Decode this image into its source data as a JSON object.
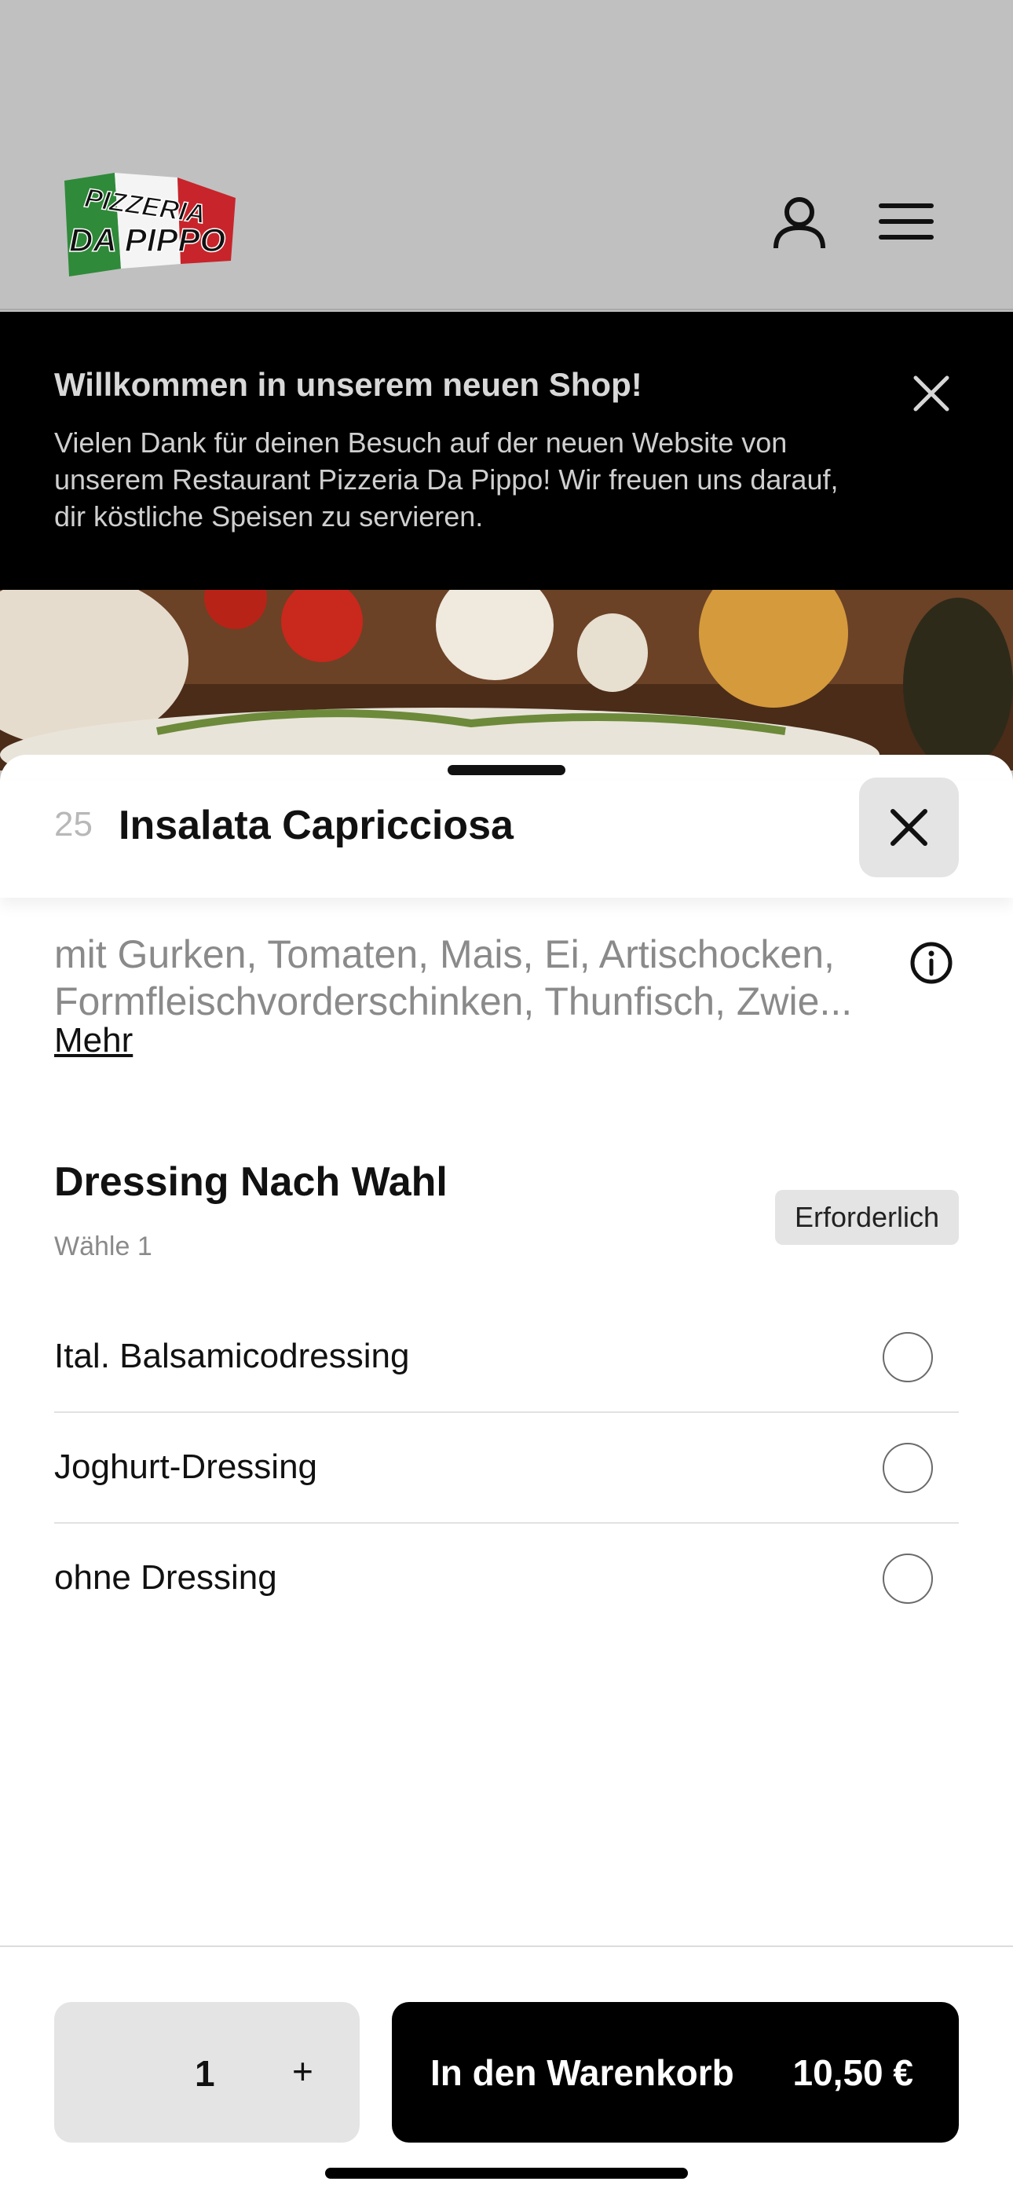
{
  "header": {
    "logo_text_top": "PIZZERIA",
    "logo_text_bottom": "DA PIPPO"
  },
  "banner": {
    "title": "Willkommen in unserem neuen Shop!",
    "text_lines": [
      "Vielen Dank für deinen Besuch auf der neuen Website von",
      "unserem Restaurant Pizzeria Da Pippo! Wir freuen uns darauf,",
      "dir köstliche Speisen zu servieren."
    ]
  },
  "item": {
    "number": "25",
    "title": "Insalata Capricciosa",
    "description_lines": [
      "mit Gurken, Tomaten, Mais, Ei, Artischocken,",
      "Formfleischvorderschinken, Thunfisch, Zwie..."
    ],
    "more_label": "Mehr"
  },
  "option_group": {
    "title": "Dressing Nach Wahl",
    "subtitle": "Wähle 1",
    "badge": "Erforderlich",
    "options": [
      {
        "label": "Ital. Balsamicodressing",
        "selected": false
      },
      {
        "label": "Joghurt-Dressing",
        "selected": false
      },
      {
        "label": "ohne Dressing",
        "selected": false
      }
    ]
  },
  "footer": {
    "quantity": "1",
    "plus_label": "+",
    "cart_label": "In den Warenkorb",
    "price": "10,50 €"
  },
  "colors": {
    "header_bg": "#c0c0c0",
    "banner_bg": "#000000",
    "button_bg": "#000000",
    "secondary_bg": "#e4e4e4"
  },
  "icons": [
    "user-icon",
    "menu-icon",
    "close-icon",
    "info-icon"
  ]
}
